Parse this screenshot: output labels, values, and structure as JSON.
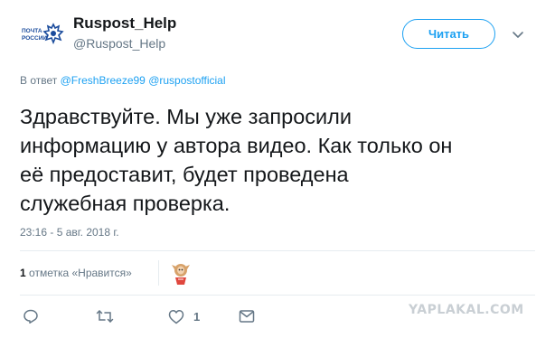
{
  "account": {
    "display_name": "Ruspost_Help",
    "username": "@Ruspost_Help",
    "logo_text_line1": "ПОЧТА",
    "logo_text_line2": "РОССИИ"
  },
  "follow_button": {
    "label": "Читать"
  },
  "reply": {
    "prefix": "В ответ",
    "mentions": [
      "@FreshBreeze99",
      "@ruspostofficial"
    ]
  },
  "tweet": {
    "lines": [
      "Здравствуйте. Мы уже запросили",
      "информацию у автора видео. Как только он",
      "её предоставит, будет проведена",
      "служебная проверка."
    ]
  },
  "timestamp": "23:16 - 5 авг. 2018 г.",
  "likes": {
    "count": "1",
    "label": "отметка «Нравится»"
  },
  "actions": {
    "reply_icon": "reply-icon",
    "retweet_icon": "retweet-icon",
    "like_icon": "heart-icon",
    "like_count": "1",
    "message_icon": "message-icon"
  },
  "watermark": "YAPLAKAL.COM"
}
